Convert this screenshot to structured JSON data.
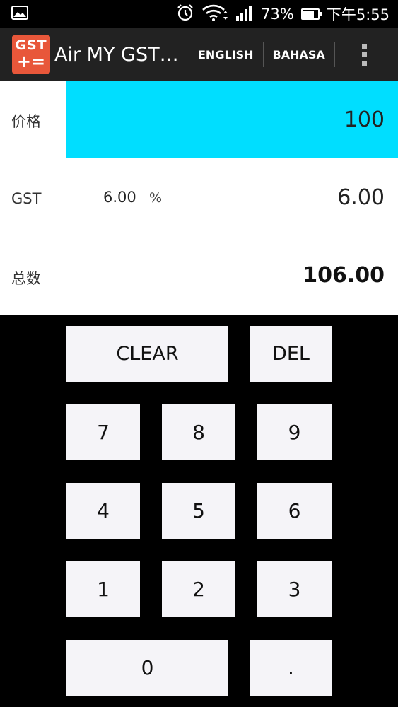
{
  "status_bar": {
    "battery_percent": "73%",
    "battery_level": 0.73,
    "time": "下午5:55"
  },
  "action_bar": {
    "logo_text": "GST",
    "logo_symbols": "+=",
    "title": "Air MY GST…",
    "actions": [
      "ENGLISH",
      "BAHASA"
    ]
  },
  "display": {
    "price_label": "价格",
    "price_value": "100",
    "gst_label": "GST",
    "gst_rate": "6.00",
    "gst_percent_symbol": "%",
    "gst_amount": "6.00",
    "total_label": "总数",
    "total_value": "106.00"
  },
  "keypad": {
    "clear": "CLEAR",
    "del": "DEL",
    "k7": "7",
    "k8": "8",
    "k9": "9",
    "k4": "4",
    "k5": "5",
    "k6": "6",
    "k1": "1",
    "k2": "2",
    "k3": "3",
    "k0": "0",
    "dot": "."
  },
  "colors": {
    "accent": "#00deff",
    "logo": "#e8573a",
    "action_bar": "#222222",
    "key_bg": "#f5f4f8"
  },
  "icons": [
    "gallery-icon",
    "alarm-icon",
    "wifi-icon",
    "signal-icon",
    "battery-icon",
    "overflow-menu-icon"
  ]
}
